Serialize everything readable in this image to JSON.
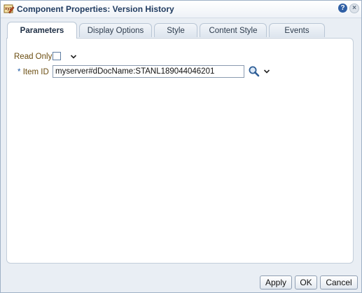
{
  "window": {
    "title": "Component Properties: Version History",
    "help_label": "?",
    "close_label": "×"
  },
  "tabs": [
    {
      "label": "Parameters",
      "active": true
    },
    {
      "label": "Display Options",
      "active": false
    },
    {
      "label": "Style",
      "active": false
    },
    {
      "label": "Content Style",
      "active": false
    },
    {
      "label": "Events",
      "active": false
    }
  ],
  "form": {
    "read_only_label": "Read Only",
    "read_only_checked": false,
    "item_id_required_marker": "*",
    "item_id_label": "Item ID",
    "item_id_value": "myserver#dDocName:STANL189044046201"
  },
  "icons": {
    "title": "component-properties-icon",
    "search": "search-icon",
    "dropdown": "chevron-down-icon"
  },
  "footer": {
    "apply_label": "Apply",
    "ok_label": "OK",
    "cancel_label": "Cancel"
  }
}
